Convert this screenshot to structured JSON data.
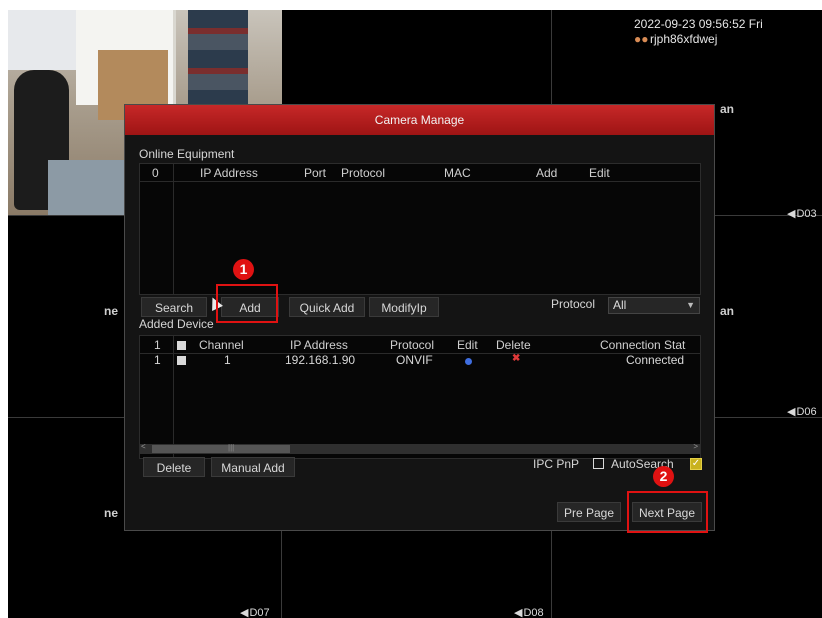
{
  "nvr": {
    "datetime": "2022-09-23 09:56:52 Fri",
    "device_name": "rjph86xfdwej",
    "channel_labels": {
      "d03": "D03",
      "d06": "D06",
      "d07": "D07",
      "d08": "D08"
    },
    "brand_fragment": "ne",
    "brand_fragment_right": "an"
  },
  "dialog": {
    "title": "Camera Manage",
    "online": {
      "label": "Online Equipment",
      "columns": [
        "0",
        "IP Address",
        "Port",
        "Protocol",
        "MAC",
        "Add",
        "Edit"
      ],
      "rows": []
    },
    "buttons": {
      "search": "Search",
      "add": "Add",
      "quick_add": "Quick Add",
      "modify_ip": "ModifyIp",
      "delete": "Delete",
      "manual_add": "Manual Add",
      "pre_page": "Pre Page",
      "next_page": "Next Page"
    },
    "protocol_filter": {
      "label": "Protocol",
      "value": "All"
    },
    "added": {
      "label": "Added Device",
      "columns": [
        "1",
        "Channel",
        "IP Address",
        "Protocol",
        "Edit",
        "Delete",
        "Connection Stat"
      ],
      "rows": [
        {
          "index": "1",
          "channel": "1",
          "ip": "192.168.1.90",
          "protocol": "ONVIF",
          "status": "Connected"
        }
      ]
    },
    "ipc_pnp_label": "IPC PnP",
    "autosearch_label": "AutoSearch",
    "autosearch_checked": true
  },
  "annotations": {
    "badge1": "1",
    "badge2": "2",
    "color": "#e01212"
  }
}
